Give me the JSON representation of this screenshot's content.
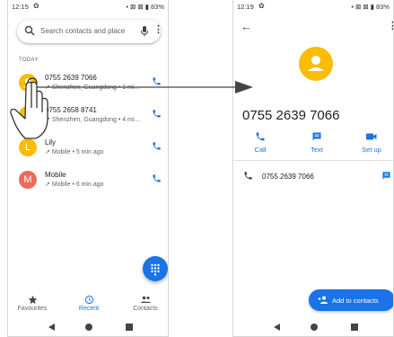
{
  "left_screen": {
    "status": {
      "time": "12:15",
      "right": "• ⊠ ⊠ ▮ 83%"
    },
    "search": {
      "placeholder": "Search contacts and place"
    },
    "section_label": "TODAY",
    "calls": [
      {
        "name": "0755 2639 7066",
        "detail": "Shenzhen, Guangdong • 1 mi...",
        "avatar_letter": "",
        "avatar_color": "#fbbc04"
      },
      {
        "name": "0755 2658 8741",
        "detail": "Shenzhen, Guangdong • 4 mi...",
        "avatar_letter": "",
        "avatar_color": "#fbbc04"
      },
      {
        "name": "Lily",
        "detail": "Mobile • 5 min ago",
        "avatar_letter": "L",
        "avatar_color": "#fbbc04"
      },
      {
        "name": "Mobile",
        "detail": "Mobile • 6 min ago",
        "avatar_letter": "M",
        "avatar_color": "#ea6a5e"
      }
    ],
    "nav": {
      "favourites": "Favourites",
      "recent": "Recent",
      "contacts": "Contacts"
    }
  },
  "right_screen": {
    "status": {
      "time": "12:19",
      "right": "• ⊠ ⊠ ▮ 83%"
    },
    "number": "0755 2639 7066",
    "actions": {
      "call": "Call",
      "text": "Text",
      "setup": "Set up"
    },
    "detail_number": "0755 2639 7066",
    "add_contact": "Add to contacts"
  },
  "colors": {
    "accent": "#1a73e8",
    "avatar_yellow": "#fbbc04",
    "avatar_red": "#ea6a5e"
  }
}
